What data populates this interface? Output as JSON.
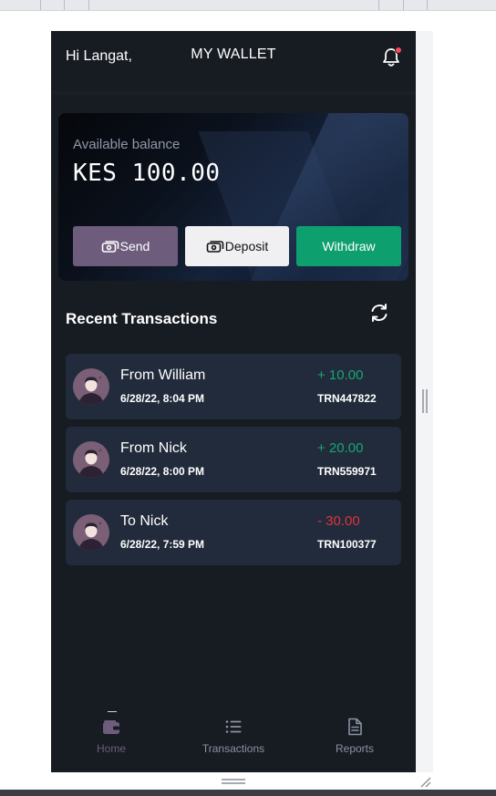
{
  "header": {
    "greeting": "Hi Langat,",
    "title": "MY WALLET",
    "notification_icon": "bell-icon",
    "has_notification": true
  },
  "balance": {
    "label": "Available balance",
    "amount": "KES 100.00"
  },
  "actions": {
    "send_label": "Send",
    "deposit_label": "Deposit",
    "withdraw_label": "Withdraw",
    "send_icon": "cash-icon",
    "deposit_icon": "cash-icon"
  },
  "recent": {
    "title": "Recent Transactions",
    "refresh_icon": "refresh-icon",
    "items": [
      {
        "name": "From William",
        "date": "6/28/22, 8:04 PM",
        "amount": "+ 10.00",
        "ref": "TRN447822",
        "direction": "in"
      },
      {
        "name": "From Nick",
        "date": "6/28/22, 8:00 PM",
        "amount": "+ 20.00",
        "ref": "TRN559971",
        "direction": "in"
      },
      {
        "name": "To Nick",
        "date": "6/28/22, 7:59 PM",
        "amount": "- 30.00",
        "ref": "TRN100377",
        "direction": "out"
      }
    ]
  },
  "nav": {
    "items": [
      {
        "label": "Home",
        "icon": "wallet-icon",
        "active": true
      },
      {
        "label": "Transactions",
        "icon": "list-icon",
        "active": false
      },
      {
        "label": "Reports",
        "icon": "document-icon",
        "active": false
      }
    ]
  },
  "colors": {
    "background": "#171b22",
    "card": "#222b3b",
    "send": "#6e5c7d",
    "withdraw": "#0e9f6e",
    "positive": "#17a673",
    "negative": "#e0323d",
    "notification_dot": "#ff4757"
  }
}
